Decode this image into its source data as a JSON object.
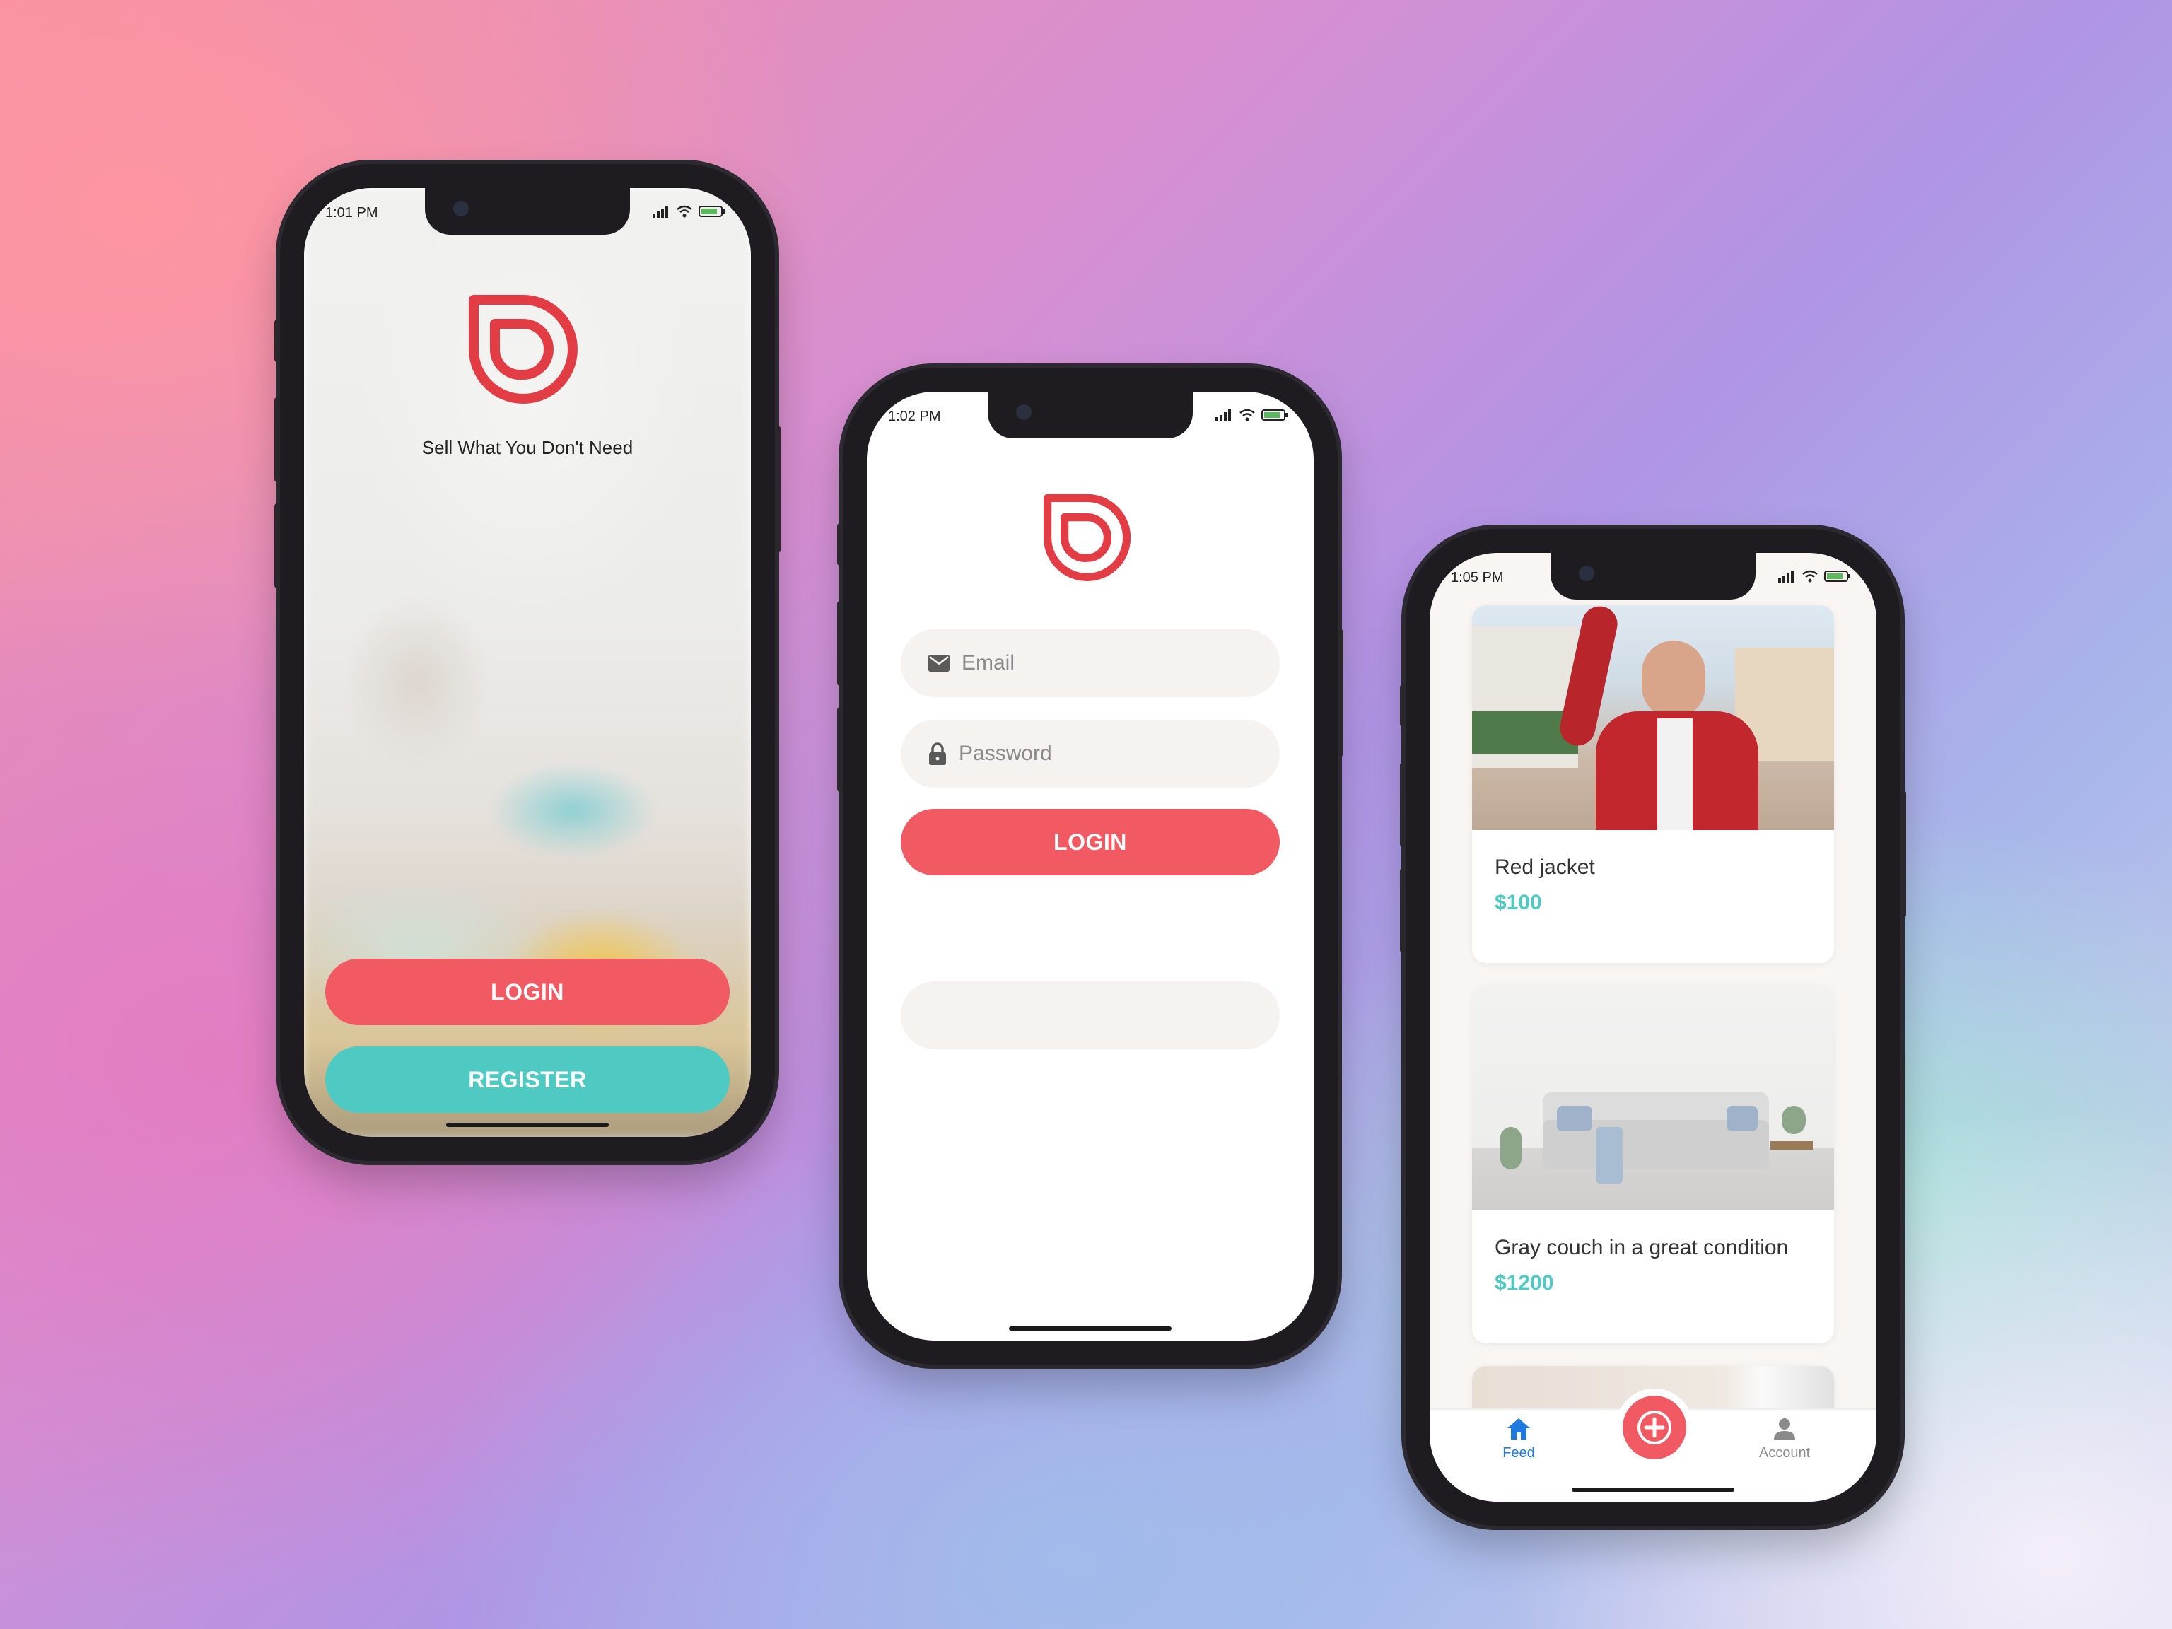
{
  "colors": {
    "brand_red": "#f15a62",
    "accent_teal": "#4fcac3",
    "tab_active": "#1f7ae0"
  },
  "splash": {
    "time": "1:01 PM",
    "tagline": "Sell What You Don't Need",
    "login_label": "LOGIN",
    "register_label": "REGISTER"
  },
  "login": {
    "time": "1:02 PM",
    "email_placeholder": "Email",
    "password_placeholder": "Password",
    "login_label": "LOGIN"
  },
  "feed": {
    "time": "1:05 PM",
    "items": [
      {
        "title": "Red jacket",
        "price": "$100"
      },
      {
        "title": "Gray couch in a great condition",
        "price": "$1200"
      }
    ],
    "tabs": {
      "feed": "Feed",
      "account": "Account"
    },
    "icons": {
      "feed": "home-icon",
      "add": "plus-circle-icon",
      "account": "person-icon"
    }
  }
}
